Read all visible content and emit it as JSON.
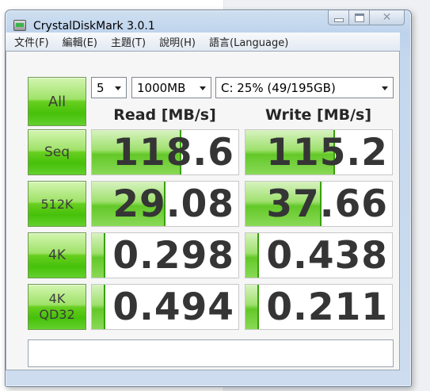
{
  "window": {
    "title": "CrystalDiskMark 3.0.1"
  },
  "menu": {
    "items": [
      "文件(F)",
      "編輯(E)",
      "主題(T)",
      "說明(H)",
      "語言(Language)"
    ]
  },
  "controls": {
    "all_label": "All",
    "count_value": "5",
    "size_value": "1000MB",
    "drive_value": "C: 25% (49/195GB)"
  },
  "headers": {
    "read": "Read [MB/s]",
    "write": "Write [MB/s]"
  },
  "rows": [
    {
      "label": [
        "Seq"
      ],
      "read": "118.6",
      "write": "115.2",
      "read_fill": 0.6,
      "write_fill": 0.6
    },
    {
      "label": [
        "512K"
      ],
      "read": "29.08",
      "write": "37.66",
      "read_fill": 0.49,
      "write_fill": 0.51
    },
    {
      "label": [
        "4K"
      ],
      "read": "0.298",
      "write": "0.438",
      "read_fill": 0.08,
      "write_fill": 0.08
    },
    {
      "label": [
        "4K",
        "QD32"
      ],
      "read": "0.494",
      "write": "0.211",
      "read_fill": 0.08,
      "write_fill": 0.08
    }
  ],
  "status": {
    "text": ""
  },
  "colors": {
    "accent_green": "#46c10a",
    "title_bar": "#c4d7ed"
  }
}
